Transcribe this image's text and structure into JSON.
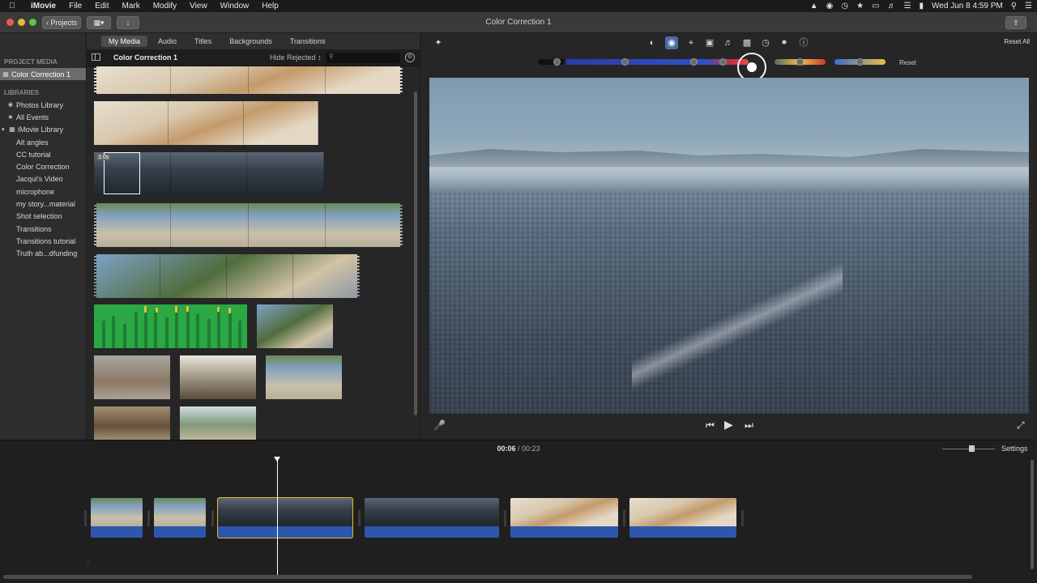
{
  "menubar": {
    "app_name": "iMovie",
    "items": [
      "File",
      "Edit",
      "Mark",
      "Modify",
      "View",
      "Window",
      "Help"
    ],
    "clock": "Wed Jun 8  4:59 PM"
  },
  "toolbar": {
    "projects_label": "Projects",
    "window_title": "Color Correction 1"
  },
  "sidebar": {
    "project_media_header": "PROJECT MEDIA",
    "project_item": "Color Correction 1",
    "libraries_header": "LIBRARIES",
    "library_items": [
      "Photos Library",
      "All Events",
      "iMovie Library"
    ],
    "events": [
      "Alt angles",
      "CC tutorial",
      "Color Correction",
      "Jacqui's Video",
      "microphone",
      "my story...material",
      "Shot selection",
      "Transitions",
      "Transitions tutorial",
      "Truth ab...dfunding"
    ]
  },
  "browser": {
    "tabs": [
      "My Media",
      "Audio",
      "Titles",
      "Backgrounds",
      "Transitions"
    ],
    "active_tab": "My Media",
    "title": "Color Correction 1",
    "filter": "Hide Rejected ↕",
    "duration_badge": "3.0s"
  },
  "viewer": {
    "reset_all": "Reset All",
    "reset": "Reset"
  },
  "timeline": {
    "current_time": "00:06",
    "separator": " / ",
    "total_time": "00:23",
    "settings": "Settings"
  },
  "colors": {
    "selection": "#e7b52a",
    "audio_track": "#2e56ad",
    "active_tool": "#4a6da8"
  }
}
